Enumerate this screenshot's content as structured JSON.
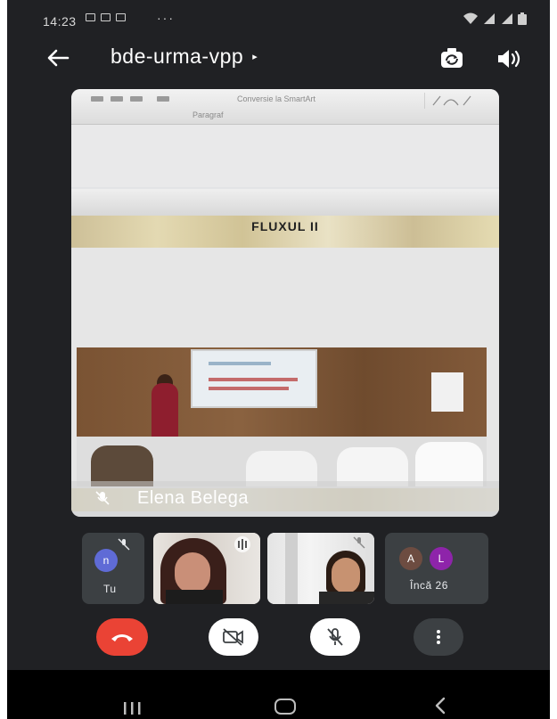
{
  "status_bar": {
    "time": "14:23",
    "more_dots": "···"
  },
  "header": {
    "meeting_code": "bde-urma-vpp",
    "caret": "▸"
  },
  "main_video": {
    "toolbar_text": "Conversie la SmartArt",
    "toolbar_group": "Paragraf",
    "slide_title": "FLUXUL II",
    "participant_name": "Elena Belega"
  },
  "tiles": {
    "self_initial": "n",
    "self_label": "Tu",
    "more_initials": [
      "A",
      "L"
    ],
    "more_label": "Încă 26"
  },
  "colors": {
    "background": "#202124",
    "end_call": "#ea4335",
    "avatar_self": "#5f6bd6",
    "avatar_a": "#6d4c41",
    "avatar_l": "#8e24aa",
    "tile": "#3c4043"
  },
  "icons": {
    "back": "arrow-left-icon",
    "switch_camera": "switch-camera-icon",
    "speaker": "speaker-icon",
    "end_call": "phone-hangup-icon",
    "camera_off": "camera-off-icon",
    "mic_off": "mic-off-icon",
    "more": "more-vert-icon"
  }
}
